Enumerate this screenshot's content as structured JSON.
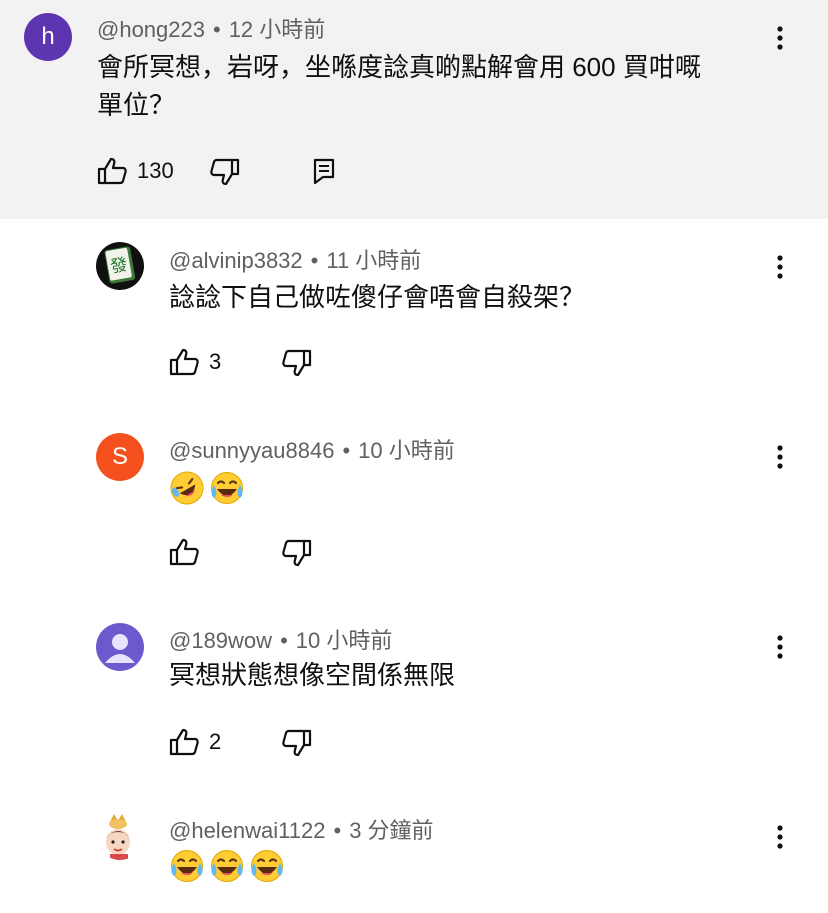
{
  "comments": [
    {
      "handle": "@hong223",
      "time": "12 小時前",
      "avatar_letter": "h",
      "text_line1": "會所冥想，岩呀，坐喺度諗真啲點解會用 600 買咁嘅",
      "text_line2": "單位？",
      "likes": "130"
    },
    {
      "handle": "@alvinip3832",
      "time": "11 小時前",
      "avatar_glyph": "發",
      "text": "諗諗下自己做咗傻仔會唔會自殺架？",
      "likes": "3"
    },
    {
      "handle": "@sunnyyau8846",
      "time": "10 小時前",
      "avatar_letter": "S",
      "emojis": [
        "rolling-on-floor-laughing",
        "tears-of-joy"
      ]
    },
    {
      "handle": "@189wow",
      "time": "10 小時前",
      "text": "冥想狀態想像空間係無限",
      "likes": "2"
    },
    {
      "handle": "@helenwai1122",
      "time": "3 分鐘前",
      "emojis": [
        "tears-of-joy",
        "tears-of-joy",
        "tears-of-joy"
      ]
    }
  ],
  "colors": {
    "top_bg": "#f2f2f2",
    "avatar_h": "#5e35b1",
    "avatar_s": "#f4511e",
    "avatar_default": "#6a5acd"
  },
  "icons": [
    "thumbs-up-icon",
    "thumbs-down-icon",
    "reply-icon",
    "more-vert-icon"
  ]
}
